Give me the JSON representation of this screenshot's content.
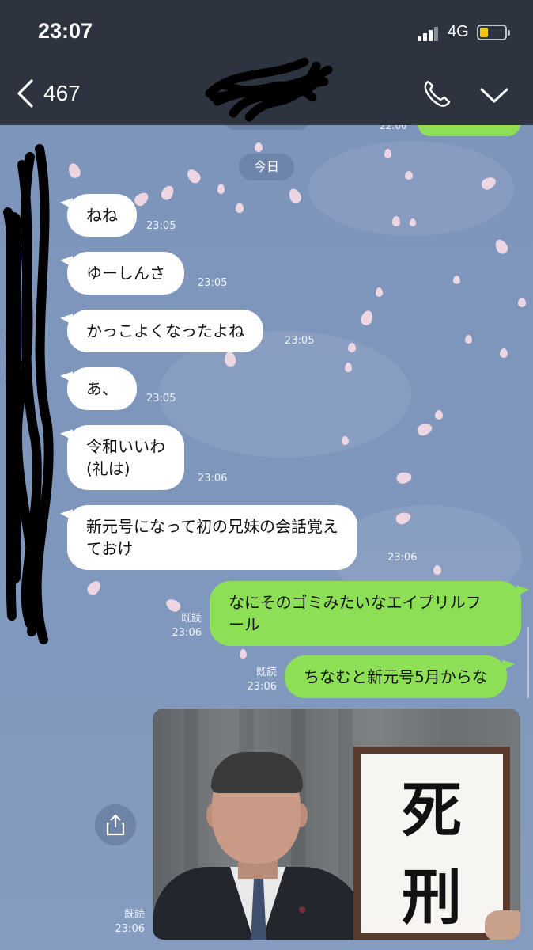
{
  "status": {
    "time": "23:07",
    "network": "4G",
    "battery_level": 0.28
  },
  "header": {
    "unread_count": "467",
    "icons": [
      "chevron-left-icon",
      "phone-icon",
      "chevron-down-icon"
    ]
  },
  "chat": {
    "date_label": "今日",
    "top_time_fragment": "22:06",
    "incoming": [
      {
        "text": "ねね",
        "time": "23:05"
      },
      {
        "text": "ゆーしんさ",
        "time": "23:05"
      },
      {
        "text": "かっこよくなったよね",
        "time": "23:05"
      },
      {
        "text": "あ、",
        "time": "23:05"
      },
      {
        "text": "令和いいわ\n(礼は)",
        "time": "23:06"
      },
      {
        "text": "新元号になって初の兄妹の会話覚え\nておけ",
        "time": "23:06"
      }
    ],
    "outgoing": [
      {
        "text": "なにそのゴミみたいなエイプリルフ\nール",
        "read": "既読",
        "time": "23:06"
      },
      {
        "text": "ちなむと新元号5月からな",
        "read": "既読",
        "time": "23:06"
      }
    ],
    "photo": {
      "board_text_top": "死",
      "board_text_bottom": "刑",
      "read": "既読",
      "time": "23:06"
    }
  },
  "colors": {
    "header_bg": "#2d3440",
    "chat_bg": "#7e96bc",
    "outgoing_bubble": "#8de055",
    "incoming_bubble": "#ffffff"
  }
}
